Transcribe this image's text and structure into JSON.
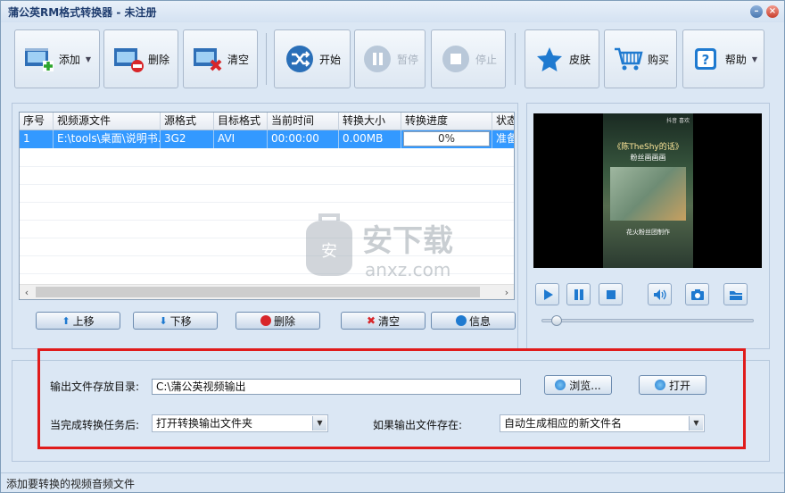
{
  "window": {
    "title": "蒲公英RM格式转换器 - 未注册"
  },
  "toolbar": {
    "add": "添加",
    "delete": "删除",
    "clear": "清空",
    "start": "开始",
    "pause": "暂停",
    "stop": "停止",
    "skin": "皮肤",
    "buy": "购买",
    "help": "帮助"
  },
  "grid": {
    "columns": [
      "序号",
      "视频源文件",
      "源格式",
      "目标格式",
      "当前时间",
      "转换大小",
      "转换进度",
      "状态"
    ],
    "rows": [
      {
        "index": "1",
        "source": "E:\\tools\\桌面\\说明书...",
        "src_format": "3G2",
        "dst_format": "AVI",
        "time": "00:00:00",
        "size": "0.00MB",
        "progress": "0%",
        "status": "准备"
      }
    ]
  },
  "list_buttons": {
    "up": "上移",
    "down": "下移",
    "delete": "删除",
    "clear": "清空",
    "info": "信息"
  },
  "video": {
    "title_line": "《陈TheShy的话》",
    "subtitle": "粉丝画画画",
    "footer": "花火粉丝团制作",
    "header_note": "抖音 喜欢"
  },
  "watermark": {
    "text": "安下载",
    "domain": "anxz.com"
  },
  "output": {
    "dir_label": "输出文件存放目录:",
    "dir_value": "C:\\蒲公英视频输出",
    "browse": "浏览...",
    "open": "打开",
    "after_label": "当完成转换任务后:",
    "after_value": "打开转换输出文件夹",
    "exists_label": "如果输出文件存在:",
    "exists_value": "自动生成相应的新文件名"
  },
  "status": {
    "text": "添加要转换的视频音频文件"
  },
  "colors": {
    "selection": "#3399ff",
    "highlight_box": "#e01b1b",
    "panel_bg": "#dbe7f4"
  }
}
